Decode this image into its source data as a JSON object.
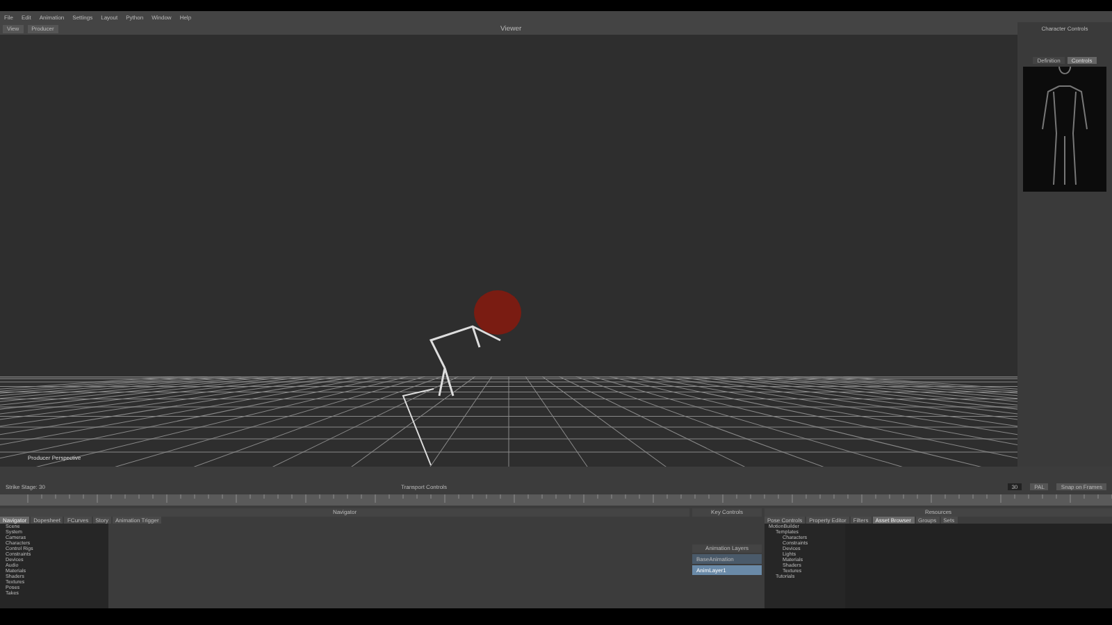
{
  "menu": [
    "File",
    "Edit",
    "Animation",
    "Settings",
    "Layout",
    "Python",
    "Window",
    "Help"
  ],
  "viewer": {
    "title": "Viewer",
    "buttons": [
      "View",
      "Producer"
    ],
    "camera_label": "Producer Perspective"
  },
  "character_controls": {
    "title": "Character Controls",
    "tabs": [
      {
        "label": "Definition",
        "selected": false
      },
      {
        "label": "Controls",
        "selected": true
      }
    ]
  },
  "transport": {
    "title": "Transport Controls",
    "stage": "Strike Stage: 30",
    "frame": "30",
    "rate": "PAL",
    "snap": "Snap on Frames"
  },
  "navigator": {
    "title": "Navigator",
    "tabs": [
      {
        "label": "Navigator",
        "selected": true
      },
      {
        "label": "Dopesheet",
        "selected": false
      },
      {
        "label": "FCurves",
        "selected": false
      },
      {
        "label": "Story",
        "selected": false
      },
      {
        "label": "Animation Trigger",
        "selected": false
      }
    ],
    "tree": [
      "Scene",
      "System",
      "Cameras",
      "Characters",
      "Control Rigs",
      "Constraints",
      "Devices",
      "Audio",
      "Materials",
      "Shaders",
      "Textures",
      "Poses",
      "Takes"
    ]
  },
  "key_controls": {
    "title": "Key Controls"
  },
  "animation_layers": {
    "title": "Animation Layers",
    "layers": [
      {
        "name": "BaseAnimation",
        "selected": false
      },
      {
        "name": "AnimLayer1",
        "selected": true
      }
    ]
  },
  "resources": {
    "title": "Resources",
    "tabs": [
      {
        "label": "Pose Controls",
        "selected": false
      },
      {
        "label": "Property Editor",
        "selected": false
      },
      {
        "label": "Filters",
        "selected": false
      },
      {
        "label": "Asset Browser",
        "selected": true
      },
      {
        "label": "Groups",
        "selected": false
      },
      {
        "label": "Sets",
        "selected": false
      }
    ],
    "tree": [
      {
        "name": "MotionBuilder",
        "children": [
          {
            "name": "Templates",
            "children": [
              {
                "name": "Characters"
              },
              {
                "name": "Constraints"
              },
              {
                "name": "Devices"
              },
              {
                "name": "Lights"
              },
              {
                "name": "Materials"
              },
              {
                "name": "Shaders"
              },
              {
                "name": "Textures"
              }
            ]
          },
          {
            "name": "Tutorials"
          }
        ]
      }
    ]
  }
}
